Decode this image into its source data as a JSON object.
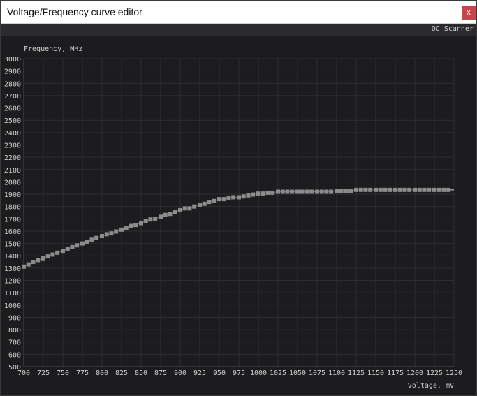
{
  "window": {
    "title": "Voltage/Frequency curve editor",
    "close_label": "x"
  },
  "toolbar": {
    "oc_scanner_label": "OC Scanner"
  },
  "chart_data": {
    "type": "scatter",
    "title": "",
    "ylabel": "Frequency, MHz",
    "xlabel": "Voltage, mV",
    "xlim": [
      700,
      1250
    ],
    "ylim": [
      500,
      3000
    ],
    "grid": true,
    "x_ticks": [
      700,
      725,
      750,
      775,
      800,
      825,
      850,
      875,
      900,
      925,
      950,
      975,
      1000,
      1025,
      1050,
      1075,
      1100,
      1125,
      1150,
      1175,
      1200,
      1225,
      1250
    ],
    "y_ticks": [
      500,
      600,
      700,
      800,
      900,
      1000,
      1100,
      1200,
      1300,
      1400,
      1500,
      1600,
      1700,
      1800,
      1900,
      2000,
      2100,
      2200,
      2300,
      2400,
      2500,
      2600,
      2700,
      2800,
      2900,
      3000
    ],
    "x": [
      700,
      706,
      712,
      718,
      725,
      731,
      737,
      743,
      750,
      756,
      762,
      768,
      775,
      781,
      787,
      793,
      800,
      806,
      812,
      818,
      825,
      831,
      837,
      843,
      850,
      856,
      862,
      868,
      875,
      881,
      887,
      893,
      900,
      906,
      912,
      918,
      925,
      931,
      937,
      943,
      950,
      956,
      962,
      968,
      975,
      981,
      987,
      993,
      1000,
      1006,
      1012,
      1018,
      1025,
      1031,
      1037,
      1043,
      1050,
      1056,
      1062,
      1068,
      1075,
      1081,
      1087,
      1093,
      1100,
      1106,
      1112,
      1118,
      1125,
      1131,
      1137,
      1143,
      1150,
      1156,
      1162,
      1168,
      1175,
      1181,
      1187,
      1193,
      1200,
      1206,
      1212,
      1218,
      1225,
      1231,
      1237,
      1243
    ],
    "y": [
      1312,
      1330,
      1350,
      1365,
      1380,
      1395,
      1410,
      1425,
      1440,
      1455,
      1470,
      1485,
      1500,
      1515,
      1530,
      1545,
      1560,
      1575,
      1582,
      1597,
      1612,
      1627,
      1642,
      1650,
      1665,
      1680,
      1695,
      1702,
      1717,
      1732,
      1740,
      1755,
      1770,
      1785,
      1785,
      1800,
      1815,
      1822,
      1837,
      1845,
      1860,
      1860,
      1867,
      1875,
      1875,
      1882,
      1890,
      1897,
      1905,
      1905,
      1912,
      1912,
      1920,
      1920,
      1920,
      1920,
      1920,
      1920,
      1920,
      1920,
      1920,
      1920,
      1920,
      1920,
      1927,
      1927,
      1927,
      1927,
      1935,
      1935,
      1935,
      1935,
      1935,
      1935,
      1935,
      1935,
      1935,
      1935,
      1935,
      1935,
      1935,
      1935,
      1935,
      1935,
      1935,
      1935,
      1935,
      1935
    ],
    "colors": {
      "grid": "#2e2e31",
      "axis": "#4a4a4c",
      "text": "#d0d0d0",
      "point": "#8c8c8c",
      "line": "#cfcfcf"
    }
  }
}
